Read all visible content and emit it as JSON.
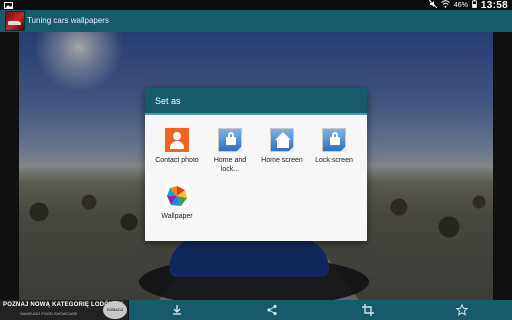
{
  "status_bar": {
    "battery_percent": "46%",
    "time": "13:58",
    "icons": [
      "image-icon",
      "mute-icon",
      "wifi-icon",
      "battery-icon"
    ]
  },
  "app_bar": {
    "title": "Tuning cars wallpapers",
    "icon": "app-car-icon"
  },
  "dialog": {
    "title": "Set as",
    "options": [
      {
        "label": "Contact photo",
        "icon": "contact-icon"
      },
      {
        "label": "Home and lock...",
        "icon": "home-lock-icon"
      },
      {
        "label": "Home screen",
        "icon": "home-screen-icon"
      },
      {
        "label": "Lock screen",
        "icon": "lock-screen-icon"
      },
      {
        "label": "Wallpaper",
        "icon": "wallpaper-icon"
      }
    ]
  },
  "bottom_bar": {
    "ad": {
      "line1": "POZNAJ NOWĄ KATEGORIĘ LODÓWEK",
      "line2": "SAMSUNG FOOD SHOWCASE",
      "badge": "ZOBACZ"
    },
    "actions": [
      "download-icon",
      "share-icon",
      "crop-icon",
      "star-icon"
    ]
  },
  "colors": {
    "app_bar": "#175a6a",
    "dialog_accent": "#3aa0b6"
  }
}
